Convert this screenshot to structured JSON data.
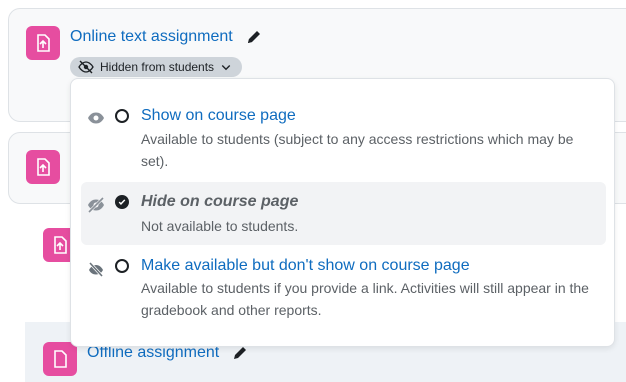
{
  "activity_1": {
    "title": "Online text assignment",
    "visibility_badge": "Hidden from students",
    "icon": "assignment-upload-icon"
  },
  "activity_4": {
    "title": "Offline assignment"
  },
  "visibility_menu": {
    "options": [
      {
        "title": "Show on course page",
        "description": "Available to students (subject to any access restrictions which may be set).",
        "icon": "eye-icon",
        "selected": false
      },
      {
        "title": "Hide on course page",
        "description": "Not available to students.",
        "icon": "eye-slash-icon",
        "selected": true
      },
      {
        "title": "Make available but don't show on course page",
        "description": "Available to students if you provide a link. Activities will still appear in the gradebook and other reports.",
        "icon": "stealth-icon",
        "selected": false
      }
    ]
  },
  "colors": {
    "link": "#0f6cbf",
    "activity_icon": "#e64da0",
    "badge_bg": "#ced4da"
  }
}
